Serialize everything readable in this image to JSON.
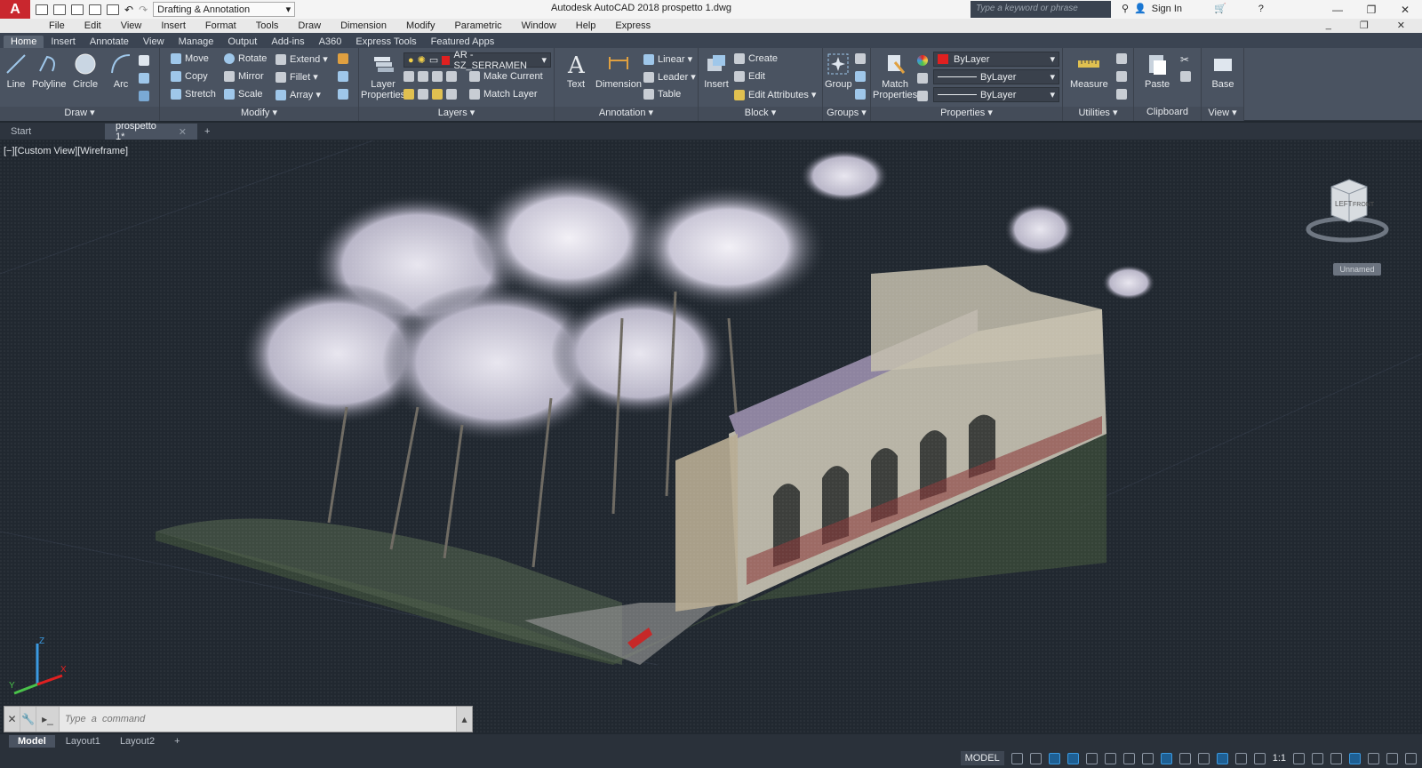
{
  "app": {
    "title": "Autodesk AutoCAD 2018    prospetto 1.dwg",
    "logo": "A",
    "workspace": "Drafting & Annotation",
    "search_placeholder": "Type a keyword or phrase",
    "signin": "Sign In"
  },
  "menu": [
    "File",
    "Edit",
    "View",
    "Insert",
    "Format",
    "Tools",
    "Draw",
    "Dimension",
    "Modify",
    "Parametric",
    "Window",
    "Help",
    "Express"
  ],
  "ribbon_tabs": [
    "Home",
    "Insert",
    "Annotate",
    "View",
    "Manage",
    "Output",
    "Add-ins",
    "A360",
    "Express Tools",
    "Featured Apps"
  ],
  "ribbon": {
    "draw": {
      "label": "Draw ▾",
      "tools": [
        "Line",
        "Polyline",
        "Circle",
        "Arc"
      ]
    },
    "modify": {
      "label": "Modify ▾",
      "tools": [
        [
          "Move",
          "Rotate",
          "Extend ▾"
        ],
        [
          "Copy",
          "Mirror",
          "Fillet ▾"
        ],
        [
          "Stretch",
          "Scale",
          "Array ▾"
        ]
      ]
    },
    "layers": {
      "label": "Layers ▾",
      "layer_props": "Layer\nProperties",
      "current_layer": "AR - SZ_SERRAMEN",
      "make_current": "Make Current",
      "match_layer": "Match Layer"
    },
    "annotation": {
      "label": "Annotation ▾",
      "text": "Text",
      "dimension": "Dimension",
      "linear": "Linear ▾",
      "leader": "Leader ▾",
      "table": "Table"
    },
    "block": {
      "label": "Block ▾",
      "insert": "Insert",
      "create": "Create",
      "edit": "Edit",
      "edit_attributes": "Edit Attributes ▾"
    },
    "groups": {
      "label": "Groups ▾",
      "group": "Group"
    },
    "properties": {
      "label": "Properties ▾",
      "match": "Match\nProperties",
      "color": "ByLayer",
      "linetype": "ByLayer",
      "lineweight": "ByLayer"
    },
    "utilities": {
      "label": "Utilities ▾",
      "measure": "Measure"
    },
    "clipboard": {
      "label": "Clipboard",
      "paste": "Paste"
    },
    "view": {
      "label": "View ▾",
      "base": "Base"
    }
  },
  "file_tabs": [
    {
      "label": "Start"
    },
    {
      "label": "prospetto 1*"
    }
  ],
  "viewport": {
    "label": "[−][Custom View][Wireframe]",
    "viewcube_left": "LEFT",
    "viewcube_front": "FRONT",
    "ucs_name": "Unnamed",
    "axis_x": "X",
    "axis_y": "Y",
    "axis_z": "Z"
  },
  "command": {
    "placeholder": "Type  a  command"
  },
  "layout_tabs": [
    "Model",
    "Layout1",
    "Layout2"
  ],
  "status": {
    "model": "MODEL",
    "scale": "1:1"
  },
  "colors": {
    "accent": "#3b9ae1",
    "logo_red": "#c9272e",
    "layer_red": "#e02020"
  }
}
